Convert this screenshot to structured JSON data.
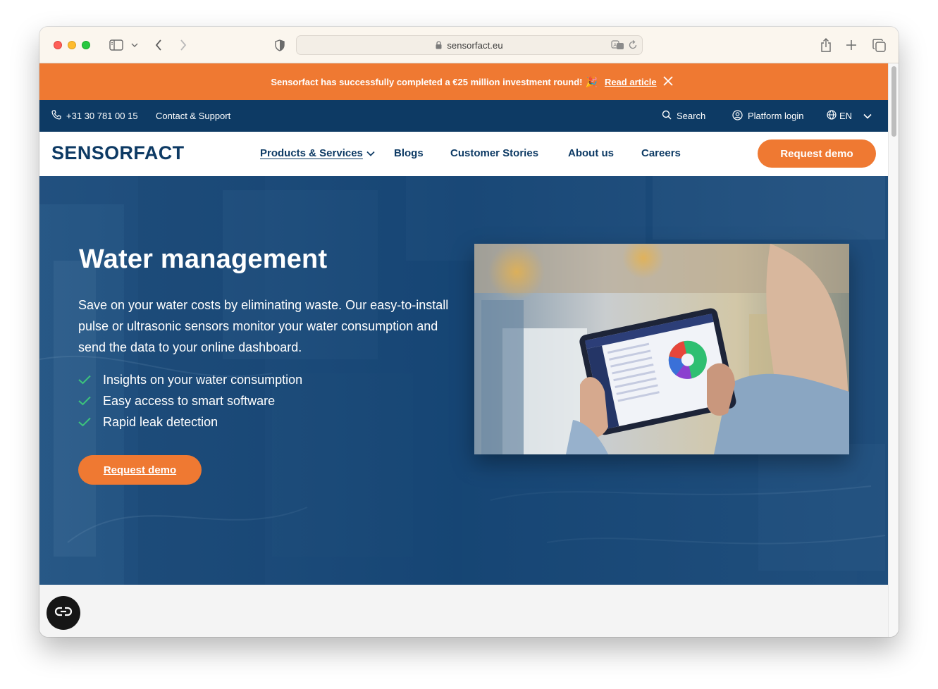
{
  "browser": {
    "url": "sensorfact.eu"
  },
  "announcement": {
    "text": "Sensorfact has successfully completed a €25 million investment round!",
    "emoji": "🎉",
    "link_label": "Read article"
  },
  "utility_bar": {
    "phone": "+31 30 781 00 15",
    "contact": "Contact & Support",
    "search": "Search",
    "login": "Platform login",
    "language": "EN"
  },
  "nav": {
    "logo": "SENSORFACT",
    "items": [
      {
        "label": "Products & Services",
        "active": true,
        "dropdown": true
      },
      {
        "label": "Blogs"
      },
      {
        "label": "Customer Stories"
      },
      {
        "label": "About us"
      },
      {
        "label": "Careers"
      }
    ],
    "cta": "Request demo"
  },
  "hero": {
    "title": "Water management",
    "description": "Save on your water costs by eliminating waste. Our easy-to-install pulse or ultrasonic sensors monitor your water consumption and send the data to your online dashboard.",
    "bullets": [
      "Insights on your water consumption",
      "Easy access to smart software",
      "Rapid leak detection"
    ],
    "cta": "Request demo"
  },
  "colors": {
    "orange": "#ef7932",
    "navy": "#0d3a64",
    "check_green": "#3cc47c"
  }
}
